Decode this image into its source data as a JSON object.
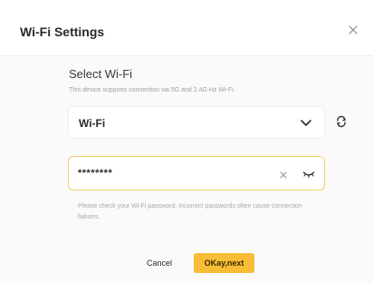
{
  "dialog": {
    "title": "Wi-Fi Settings",
    "close_icon": "close-icon"
  },
  "wifi": {
    "section_title": "Select Wi-Fi",
    "section_subtitle": "This device supports connection via 5G and 2.4G Hz Wi-Fi.",
    "selected_network": "Wi-Fi",
    "dropdown_icon": "chevron-down-icon",
    "refresh_icon": "refresh-icon"
  },
  "password": {
    "masked_value": "********",
    "clear_icon": "clear-icon",
    "visibility_icon": "eye-closed-icon",
    "hint": "Please check your Wi-Fi password. Incorrect passwords often cause connection failures."
  },
  "actions": {
    "cancel_label": "Cancel",
    "ok_label": "OKay,next"
  },
  "colors": {
    "accent": "#f7bd37",
    "focus_border": "#f5cf6e",
    "muted_text": "#a8a8a8"
  }
}
